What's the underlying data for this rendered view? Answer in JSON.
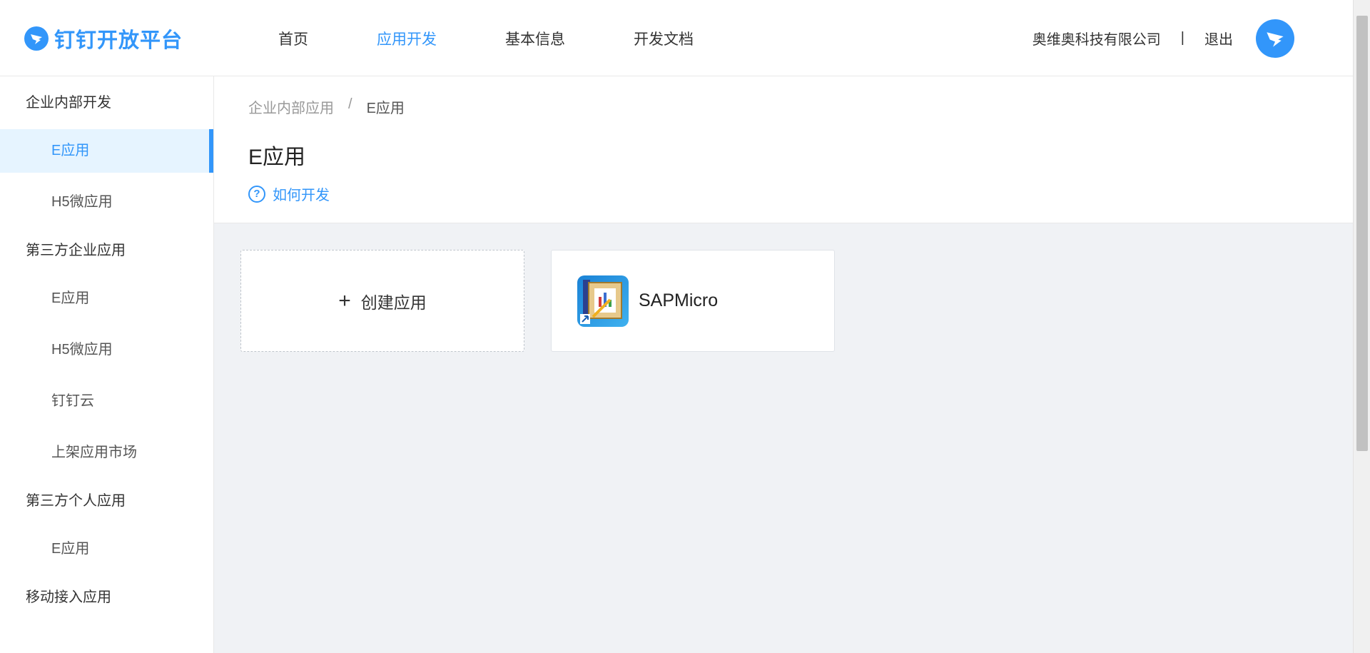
{
  "header": {
    "logo_text": "钉钉开放平台",
    "nav": [
      {
        "label": "首页"
      },
      {
        "label": "应用开发"
      },
      {
        "label": "基本信息"
      },
      {
        "label": "开发文档"
      }
    ],
    "active_nav_index": 1,
    "company": "奥维奥科技有限公司",
    "separator": "|",
    "logout": "退出"
  },
  "sidebar": {
    "groups": [
      {
        "label": "企业内部开发",
        "items": [
          {
            "label": "E应用"
          },
          {
            "label": "H5微应用"
          }
        ]
      },
      {
        "label": "第三方企业应用",
        "items": [
          {
            "label": "E应用"
          },
          {
            "label": "H5微应用"
          },
          {
            "label": "钉钉云"
          },
          {
            "label": "上架应用市场"
          }
        ]
      },
      {
        "label": "第三方个人应用",
        "items": [
          {
            "label": "E应用"
          }
        ]
      },
      {
        "label": "移动接入应用",
        "items": []
      }
    ],
    "active_item": "企业内部开发 / E应用"
  },
  "main": {
    "breadcrumb": {
      "parent": "企业内部应用",
      "separator": "/",
      "current": "E应用"
    },
    "title": "E应用",
    "howto_label": "如何开发",
    "create_card_label": "创建应用",
    "apps": [
      {
        "name": "SAPMicro"
      }
    ]
  },
  "colors": {
    "accent": "#3296fa",
    "page_bg": "#f0f2f5"
  }
}
